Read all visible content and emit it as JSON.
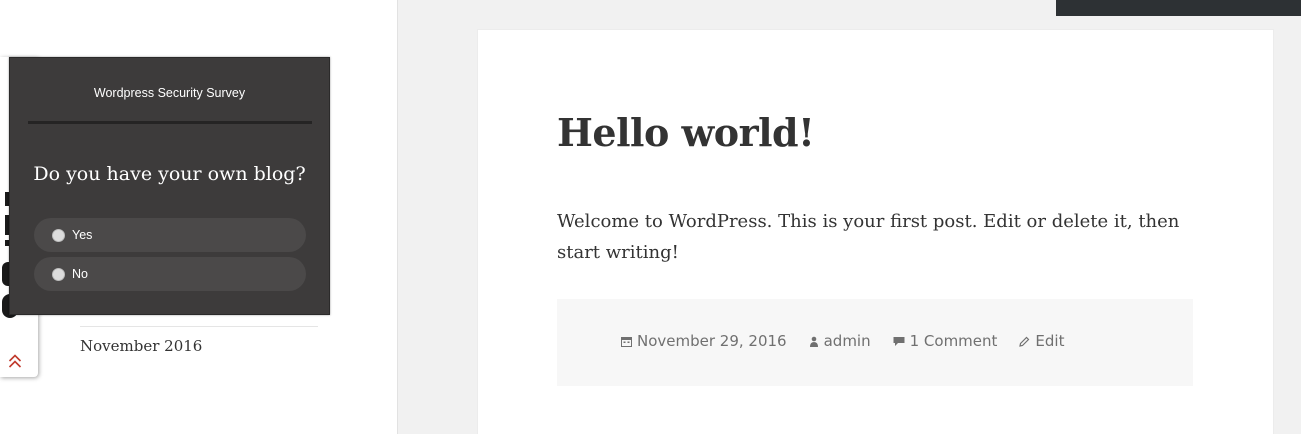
{
  "sidebar": {
    "archive_item": "November 2016"
  },
  "post": {
    "title": "Hello world!",
    "content": "Welcome to WordPress. This is your first post. Edit or delete it, then start writing!",
    "meta": {
      "date": "November 29, 2016",
      "author": "admin",
      "comments": "1 Comment",
      "edit": "Edit"
    }
  },
  "survey": {
    "title": "Wordpress Security Survey",
    "question": "Do you have your own blog?",
    "options": [
      {
        "label": "Yes"
      },
      {
        "label": "No"
      }
    ]
  },
  "colors": {
    "panel": "#3d3b3b",
    "option_bg": "#4b4949",
    "text_dark": "#333333",
    "meta_text": "#707070",
    "chevron": "#c0392b"
  }
}
